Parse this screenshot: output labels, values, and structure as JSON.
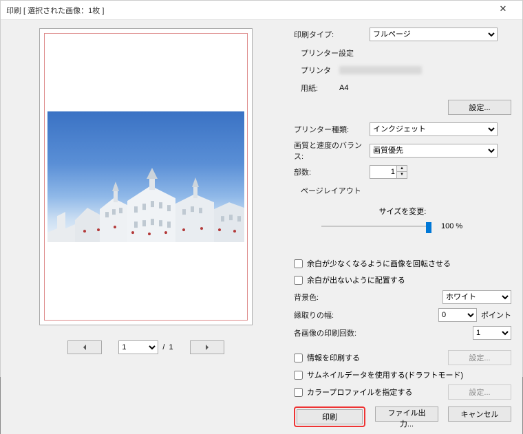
{
  "window": {
    "title": "印刷 [ 選択された画像：1枚 ]"
  },
  "pager": {
    "current": "1",
    "sep": "/",
    "total": "1"
  },
  "right": {
    "printType": {
      "label": "印刷タイプ:",
      "value": "フルページ"
    },
    "printerSettings": {
      "label": "プリンター設定"
    },
    "printer": {
      "label": "プリンタ"
    },
    "paper": {
      "label": "用紙:",
      "value": "A4"
    },
    "settingsBtn": "設定...",
    "printerKind": {
      "label": "プリンター種類:",
      "value": "インクジェット"
    },
    "qualityBalance": {
      "label": "画質と速度のバランス:",
      "value": "画質優先"
    },
    "copies": {
      "label": "部数:",
      "value": "1"
    },
    "pageLayoutLabel": "ページレイアウト",
    "resize": {
      "label": "サイズを変更:",
      "percent": "100 %"
    },
    "rotateLessMargin": "余白が少なくなるように画像を回転させる",
    "fitNoMargin": "余白が出ないように配置する",
    "bgColor": {
      "label": "背景色:",
      "value": "ホワイト"
    },
    "borderWidth": {
      "label": "縁取りの幅:",
      "value": "0",
      "unit": "ポイント"
    },
    "printCountEach": {
      "label": "各画像の印刷回数:",
      "value": "1"
    },
    "printInfo": "情報を印刷する",
    "useThumbnail": "サムネイルデータを使用する(ドラフトモード)",
    "specifyColorProfile": "カラープロファイルを指定する",
    "settingsBtn2": "設定...",
    "settingsBtn3": "設定...",
    "printBtn": "印刷",
    "fileOutputBtn": "ファイル出力...",
    "cancelBtn": "キャンセル"
  }
}
